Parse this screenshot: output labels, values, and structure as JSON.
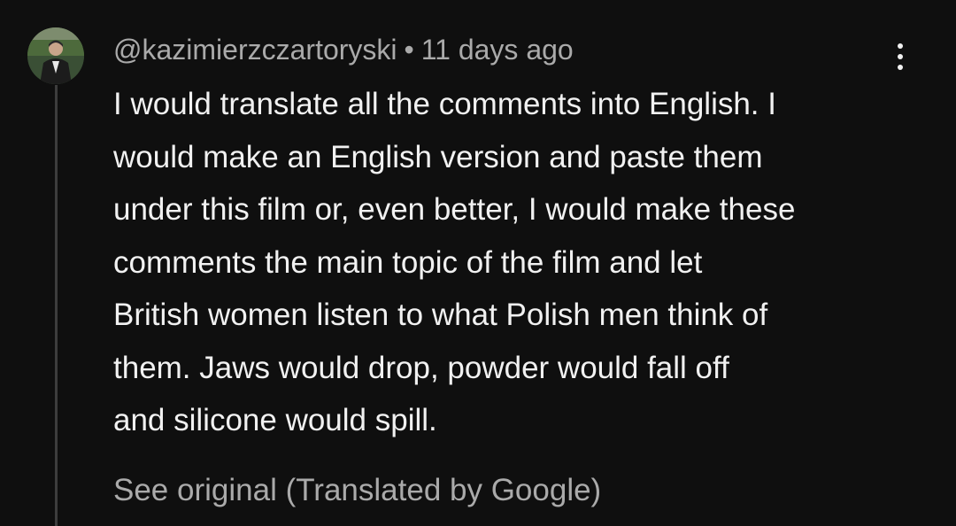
{
  "comment": {
    "author": "@kazimierzczartoryski",
    "separator": "•",
    "timestamp": "11 days ago",
    "text_lines": [
      "I would translate all the comments into English. I",
      "would make an English version and paste them",
      "under this film or, even better, I would make these",
      "comments the main topic of the film and let",
      "British women listen to what Polish men think of",
      "them. Jaws would drop, powder would fall off",
      "and silicone would spill."
    ],
    "see_original_label": "See original (Translated by Google)",
    "menu_icon": "more-vert-icon",
    "avatar_icon": "user-avatar"
  },
  "colors": {
    "background": "#0f0f0f",
    "primary_text": "#f1f1f1",
    "secondary_text": "#aaaaaa",
    "thread_line": "#3d3d3d"
  }
}
